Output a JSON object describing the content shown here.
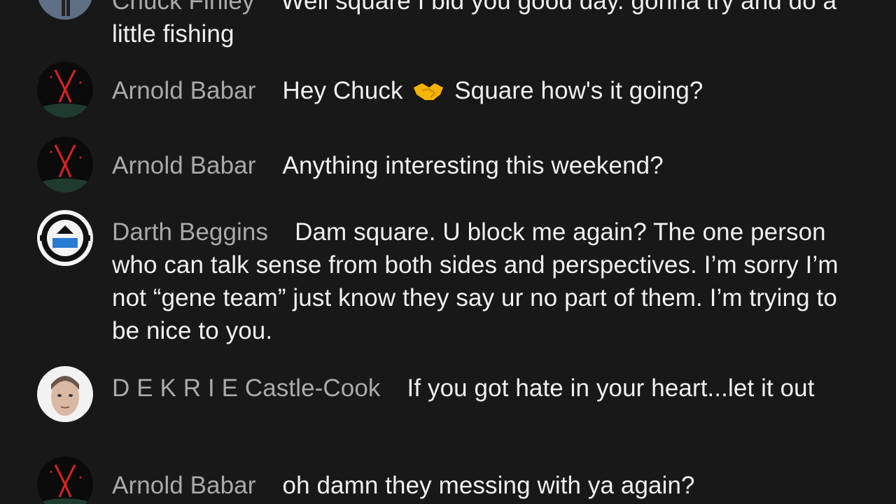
{
  "messages": [
    {
      "author": "Chuck Finley",
      "avatar": "chuck-avatar",
      "text": "Well square I bid you good day. gonna try and do a little fishing"
    },
    {
      "author": "Arnold Babar",
      "avatar": "arnold-avatar",
      "text_before": "Hey Chuck",
      "emoji": "handshake-emoji",
      "text_after": "Square how's it going?"
    },
    {
      "author": "Arnold Babar",
      "avatar": "arnold-avatar",
      "text": "Anything interesting this weekend?"
    },
    {
      "author": "Darth Beggins",
      "avatar": "darth-avatar",
      "text": "Dam square. U block me again? The one person who can talk sense from both sides and perspectives. I’m sorry I’m not “gene team” just know they say ur no part of them. I’m trying to be nice to you."
    },
    {
      "author": "D E K R I E Castle-Cook",
      "avatar": "dekrie-avatar",
      "text": "If you got hate in your heart...let it out"
    },
    {
      "author": "Arnold Babar",
      "avatar": "arnold-avatar",
      "text": "oh damn they messing with ya again?"
    }
  ],
  "colors": {
    "background": "#181818",
    "author": "#aaaaaa",
    "message": "#f1f1f1"
  }
}
